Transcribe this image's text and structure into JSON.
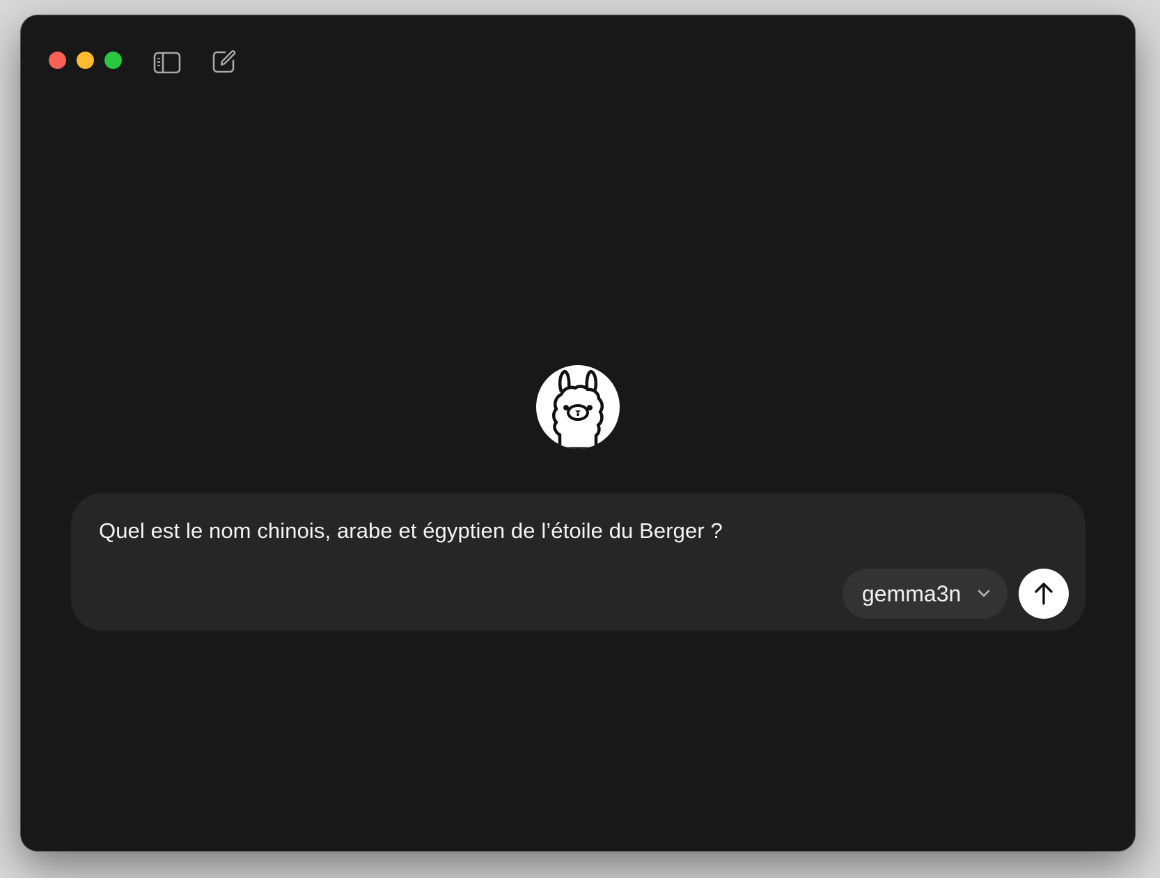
{
  "window": {
    "controls": {
      "close": "close",
      "minimize": "minimize",
      "maximize": "zoom"
    },
    "toolbar": {
      "sidebar_icon": "sidebar-toggle-icon",
      "compose_icon": "new-chat-icon"
    }
  },
  "main": {
    "logo_icon": "llama-logo-icon"
  },
  "composer": {
    "prompt_text": "Quel est le nom chinois, arabe et égyptien de l’étoile du Berger ?",
    "model": {
      "selected": "gemma3n",
      "icon": "chevron-down-icon"
    },
    "send_icon": "arrow-up-icon"
  },
  "colors": {
    "window_bg": "#181818",
    "composer_bg": "#262626",
    "model_pill_bg": "#333333",
    "close": "#fe5f57",
    "minimize": "#febc2e",
    "maximize": "#28c840"
  }
}
